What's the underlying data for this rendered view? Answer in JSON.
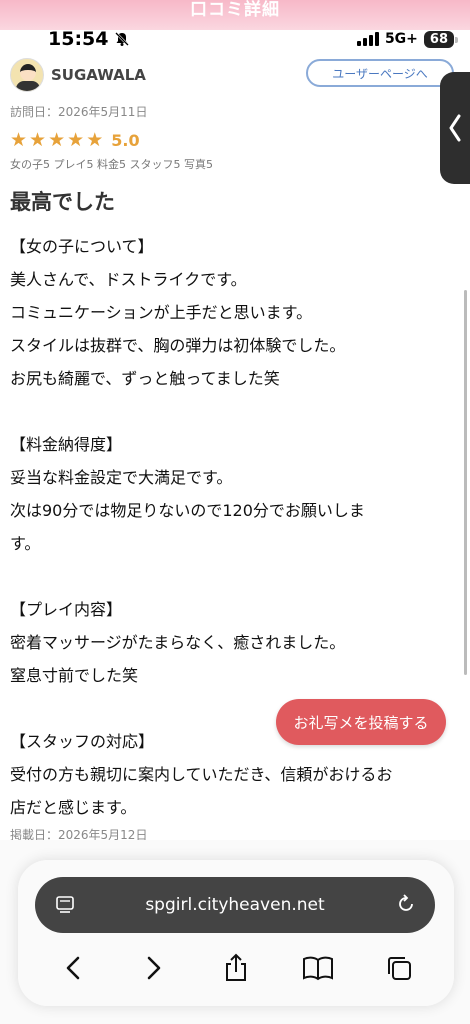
{
  "header": {
    "title": "口コミ詳細"
  },
  "status_bar": {
    "time": "15:54",
    "network": "5G+",
    "battery": "68"
  },
  "user": {
    "name": "SUGAWALA",
    "user_page_button": "ユーザーページへ"
  },
  "review": {
    "visit_date": "訪問日：2026年5月11日",
    "rating": "5.0",
    "stars": 5,
    "sub_scores": "女の子5 プレイ5 料金5 スタッフ5 写真5",
    "title": "最高でした",
    "body_lines": [
      "【女の子について】",
      "美人さんで、ドストライクです。",
      "コミュニケーションが上手だと思います。",
      "スタイルは抜群で、胸の弾力は初体験でした。",
      "お尻も綺麗で、ずっと触ってました笑",
      "",
      "【料金納得度】",
      "妥当な料金設定で大満足です。",
      "次は90分では物足りないので120分でお願いしま",
      "す。",
      "",
      "【プレイ内容】",
      "密着マッサージがたまらなく、癒されました。",
      "窒息寸前でした笑",
      "",
      "【スタッフの対応】",
      "受付の方も親切に案内していただき、信頼がおけるお",
      "店だと感じます。"
    ],
    "post_date": "掲載日：2026年5月12日"
  },
  "floating_button": {
    "label": "お礼写メを投稿する"
  },
  "browser": {
    "url": "spgirl.cityheaven.net"
  },
  "icons": {
    "side_tab": "chevron-left-icon",
    "tabs": "tab-overview-icon",
    "reload": "reload-icon",
    "back": "chevron-left-icon",
    "forward": "chevron-right-icon",
    "share": "share-icon",
    "bookmarks": "book-icon",
    "tabs_button": "tabs-icon"
  }
}
